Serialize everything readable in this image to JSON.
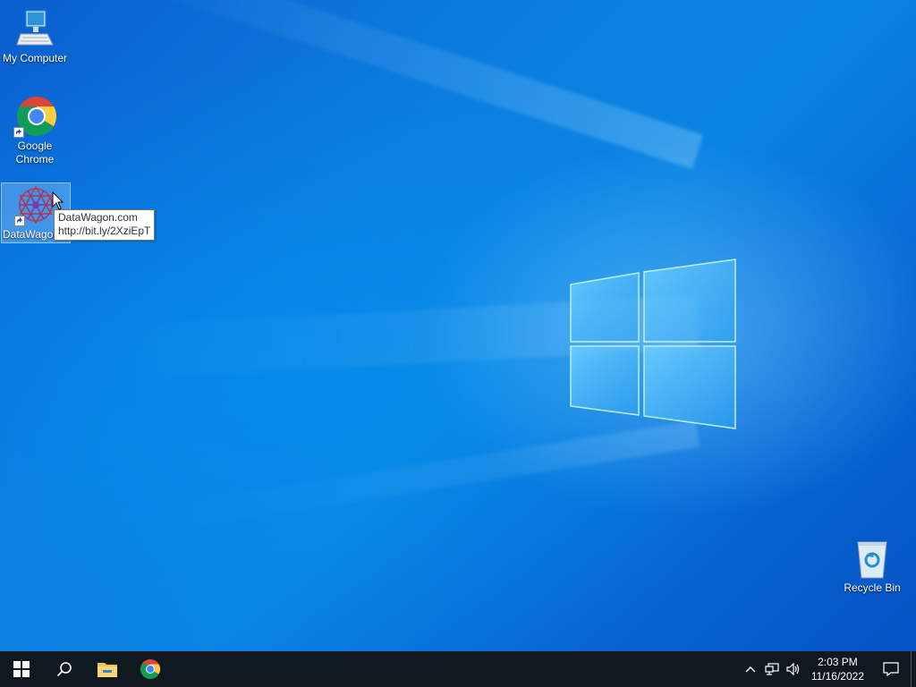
{
  "desktop": {
    "icons": [
      {
        "label": "My Computer",
        "icon": "computer-icon"
      },
      {
        "label": "Google Chrome",
        "icon": "chrome-icon"
      },
      {
        "label": "DataWagon",
        "icon": "datawagon-icon"
      },
      {
        "label": "Recycle Bin",
        "icon": "recycle-bin-icon"
      }
    ],
    "tooltip": {
      "line1": "DataWagon.com",
      "line2": "http://bit.ly/2XziEpT"
    }
  },
  "taskbar": {
    "pinned": [
      {
        "icon": "windows-start-icon"
      },
      {
        "icon": "search-icon"
      },
      {
        "icon": "file-explorer-icon"
      },
      {
        "icon": "chrome-icon"
      }
    ],
    "tray_icons": [
      "chevron-up-icon",
      "network-icon",
      "volume-icon"
    ],
    "clock": {
      "time": "2:03 PM",
      "date": "11/16/2022"
    },
    "notification_icon": "action-center-icon"
  },
  "colors": {
    "wallpaper": "#0a7ee0",
    "taskbar": "#101820"
  }
}
